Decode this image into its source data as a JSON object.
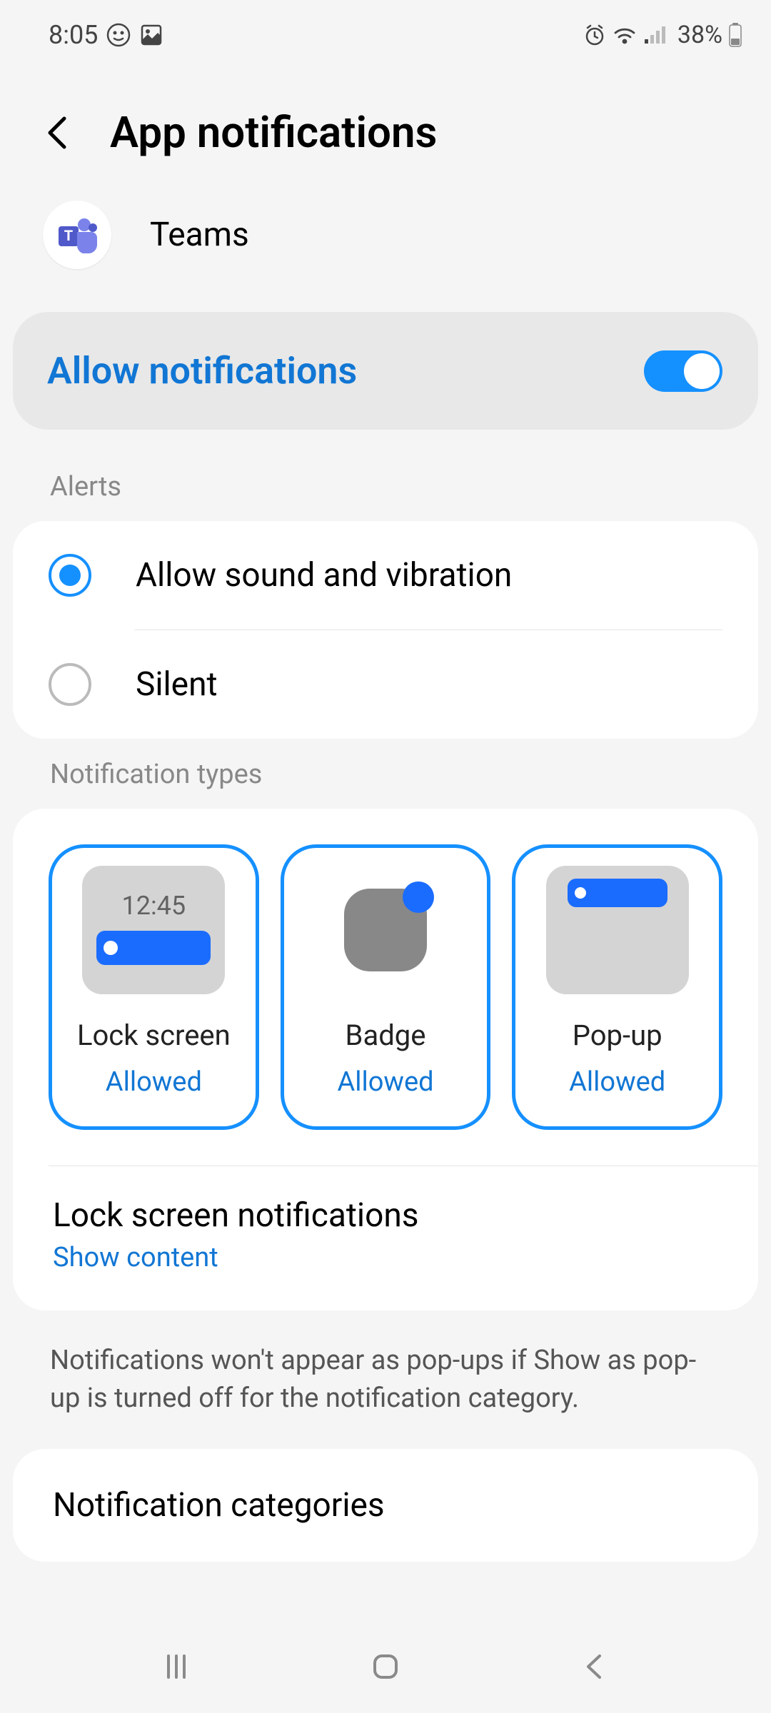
{
  "status_bar": {
    "time": "8:05",
    "battery": "38%"
  },
  "header": {
    "title": "App notifications"
  },
  "app": {
    "name": "Teams"
  },
  "master": {
    "label": "Allow notifications",
    "enabled": true
  },
  "alerts": {
    "section_label": "Alerts",
    "options": [
      {
        "label": "Allow sound and vibration",
        "selected": true
      },
      {
        "label": "Silent",
        "selected": false
      }
    ]
  },
  "notif_types": {
    "section_label": "Notification types",
    "lock_preview_time": "12:45",
    "cards": [
      {
        "title": "Lock screen",
        "status": "Allowed"
      },
      {
        "title": "Badge",
        "status": "Allowed"
      },
      {
        "title": "Pop-up",
        "status": "Allowed"
      }
    ]
  },
  "lock_screen_notifications": {
    "title": "Lock screen notifications",
    "subtitle": "Show content"
  },
  "info": "Notifications won't appear as pop-ups if Show as pop-up is turned off for the notification category.",
  "categories": {
    "label": "Notification categories"
  }
}
